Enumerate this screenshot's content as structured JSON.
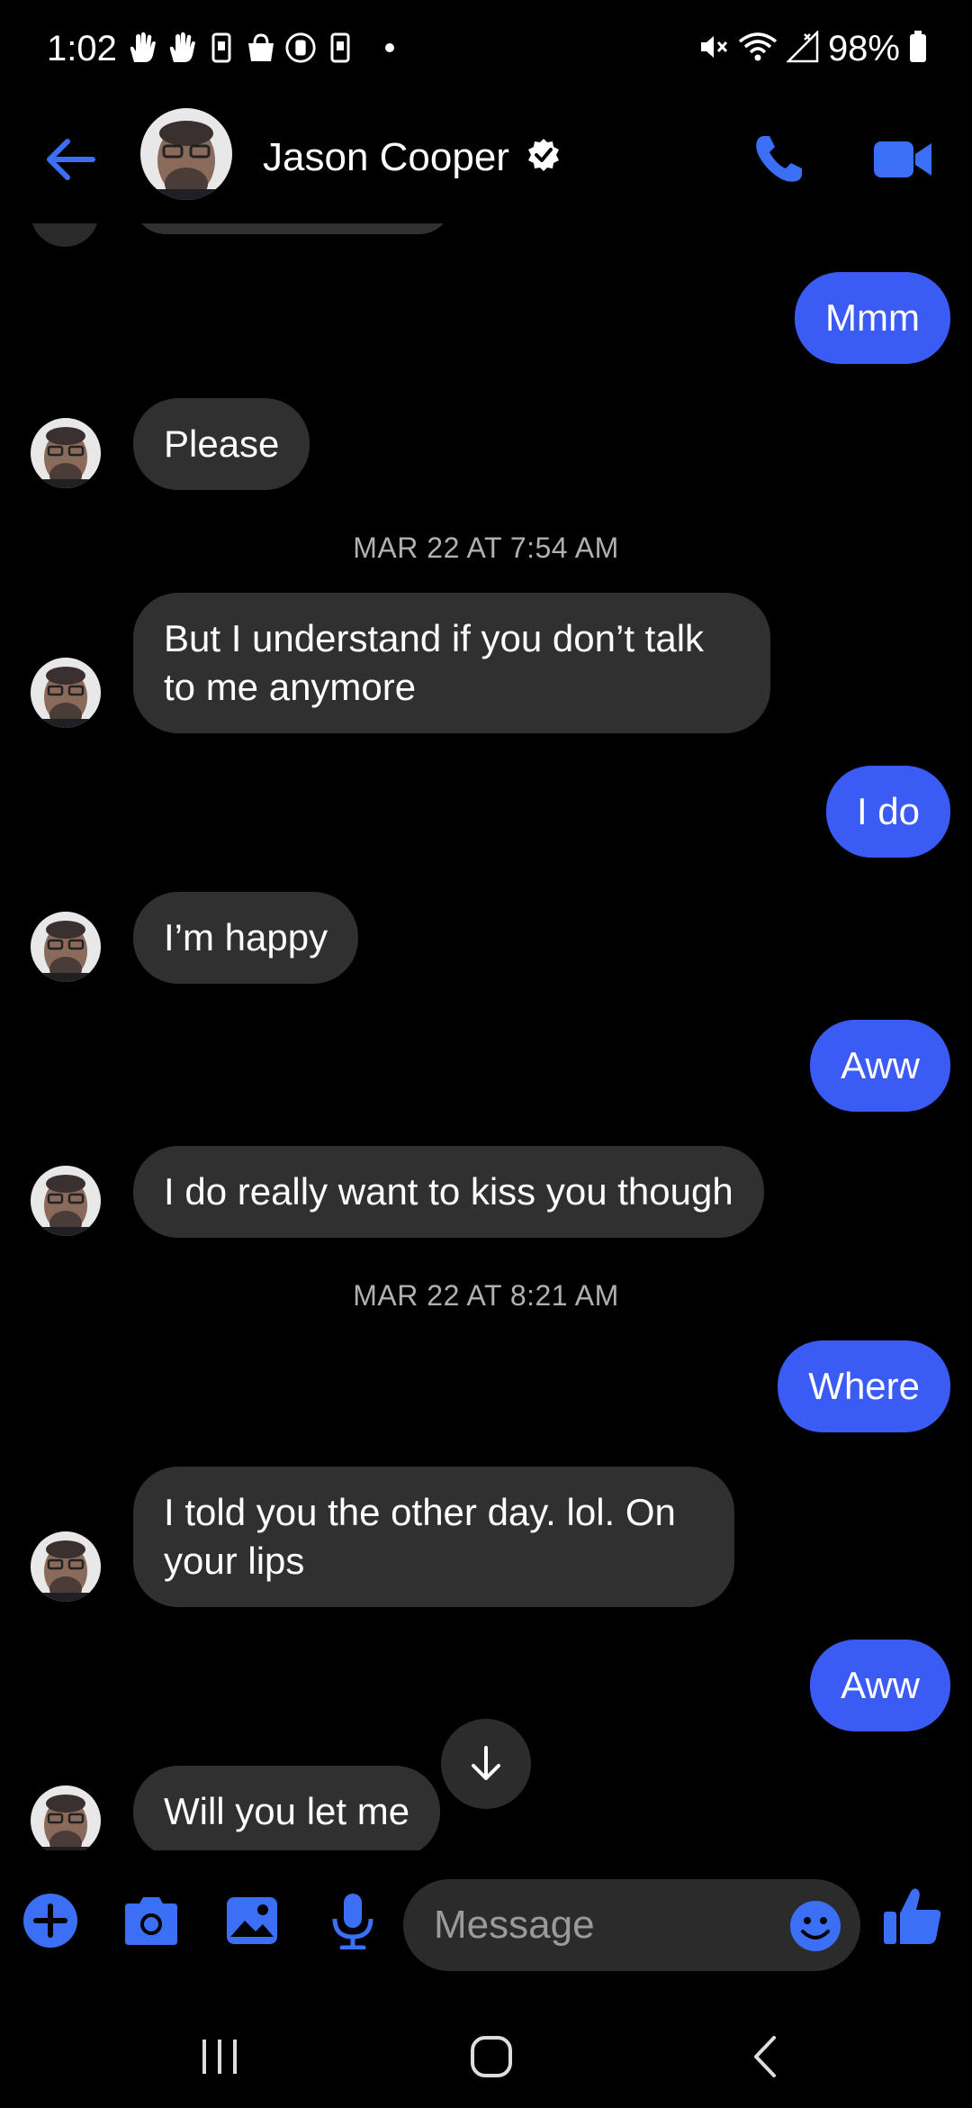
{
  "status_bar": {
    "time": "1:02",
    "battery": "98%",
    "icons": [
      "hand-icon",
      "hand-icon",
      "phone-icon",
      "bag-icon",
      "timer-icon",
      "phone-icon",
      "mute-icon",
      "wifi-icon",
      "signal-icon",
      "battery-icon"
    ]
  },
  "header": {
    "contact_name": "Jason Cooper",
    "verified": true,
    "accent_color": "#3b6ff5"
  },
  "messages": [
    {
      "side": "out",
      "text": "Mmm"
    },
    {
      "side": "in",
      "text": "Please"
    },
    {
      "type": "timestamp",
      "text": "MAR 22 AT 7:54 AM"
    },
    {
      "side": "in",
      "text": "But I understand if you don’t talk to me anymore"
    },
    {
      "side": "out",
      "text": "I do"
    },
    {
      "side": "in",
      "text": "I’m happy"
    },
    {
      "side": "out",
      "text": "Aww"
    },
    {
      "side": "in",
      "text": "I do really want to kiss you though"
    },
    {
      "type": "timestamp",
      "text": "MAR 22 AT 8:21 AM"
    },
    {
      "side": "out",
      "text": "Where"
    },
    {
      "side": "in",
      "text": "I told you the other day. lol. On your lips"
    },
    {
      "side": "out",
      "text": "Aww"
    },
    {
      "side": "in",
      "text": "Will you let me"
    }
  ],
  "composer": {
    "placeholder": "Message"
  },
  "colors": {
    "outgoing_bubble": "#3b5bf5",
    "incoming_bubble": "#303030",
    "accent": "#3b6ff5"
  }
}
